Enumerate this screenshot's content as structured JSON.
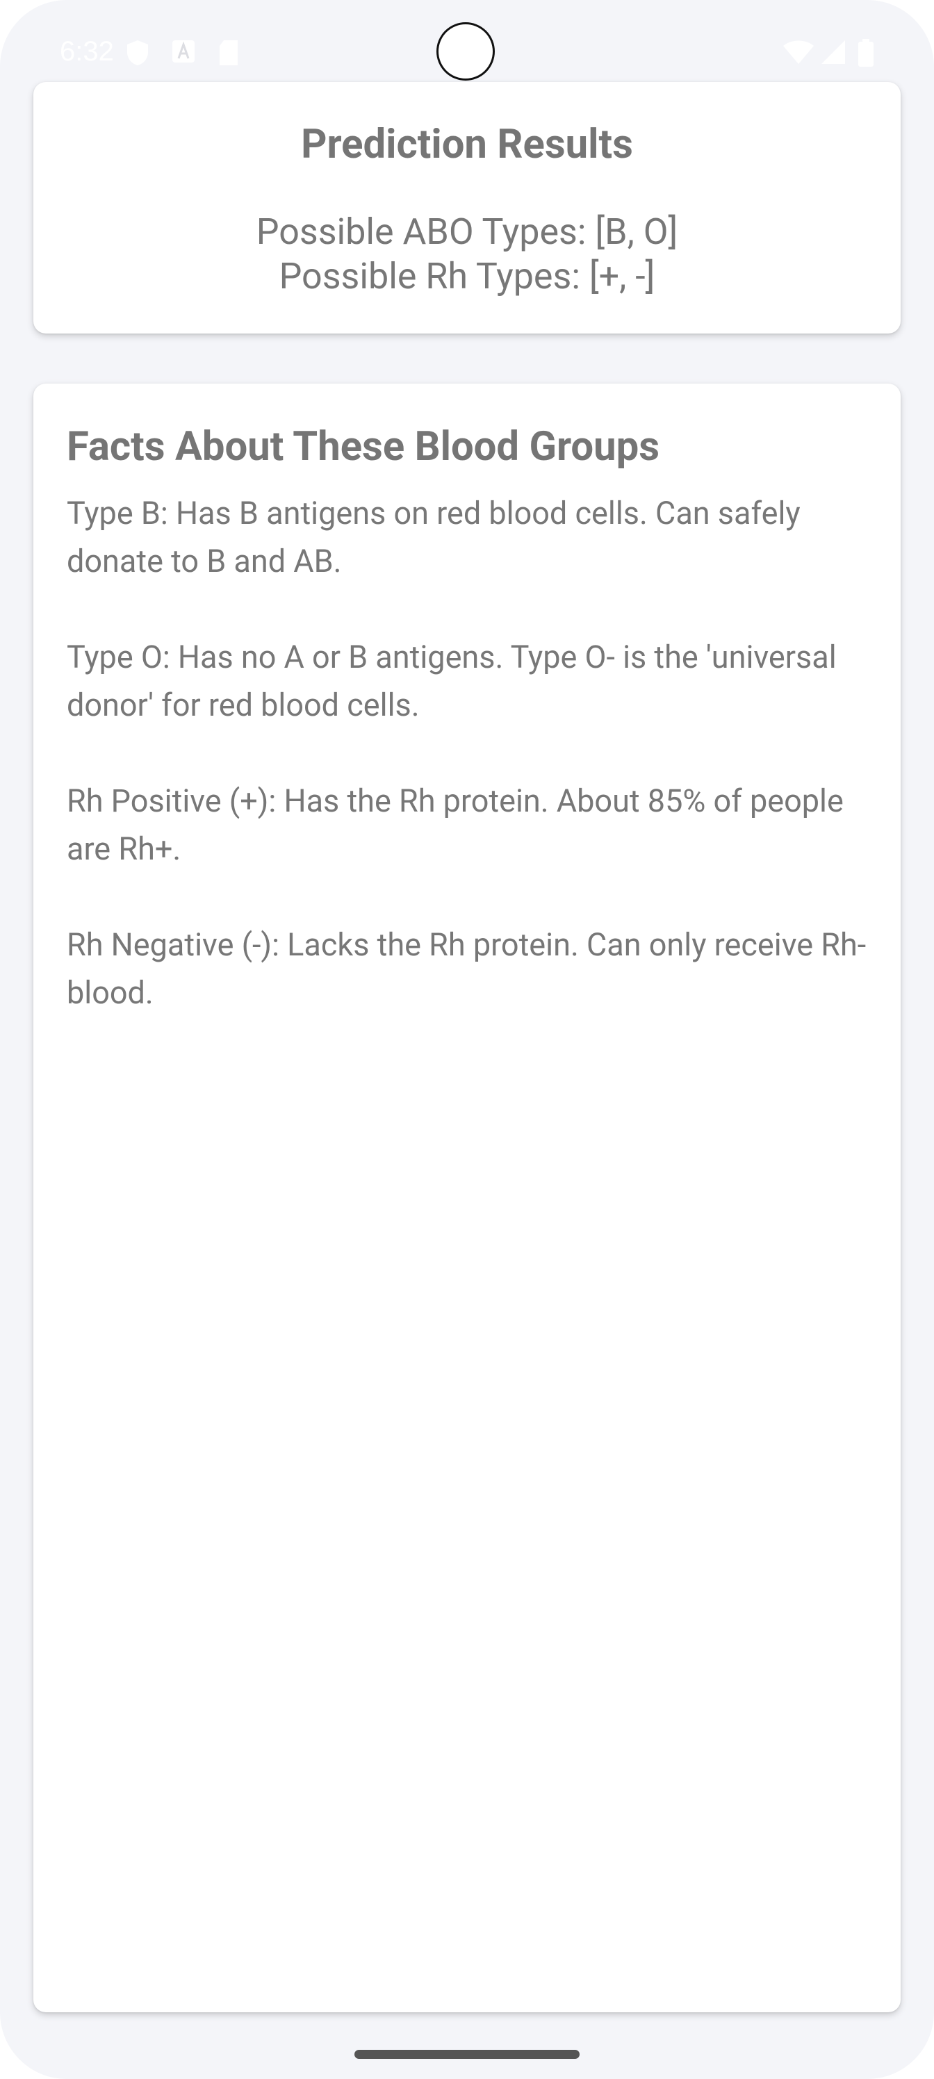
{
  "status_bar": {
    "time": "6:32",
    "icons": [
      "shield-icon",
      "font-a-icon",
      "sd-card-icon",
      "wifi-icon",
      "signal-icon",
      "battery-icon"
    ]
  },
  "results": {
    "title": "Prediction Results",
    "abo_line": "Possible ABO Types: [B, O]",
    "rh_line": "Possible Rh Types: [+, -]"
  },
  "facts": {
    "title": "Facts About These Blood Groups",
    "items": [
      "Type B: Has B antigens on red blood cells. Can safely donate to B and AB.",
      "Type O: Has no A or B antigens. Type O- is the 'universal donor' for red blood cells.",
      "Rh Positive (+): Has the Rh protein. About 85% of people are Rh+.",
      "Rh Negative (-): Lacks the Rh protein. Can only receive Rh- blood."
    ]
  },
  "colors": {
    "background": "#f4f5f9",
    "card": "#ffffff",
    "text": "#777777"
  }
}
